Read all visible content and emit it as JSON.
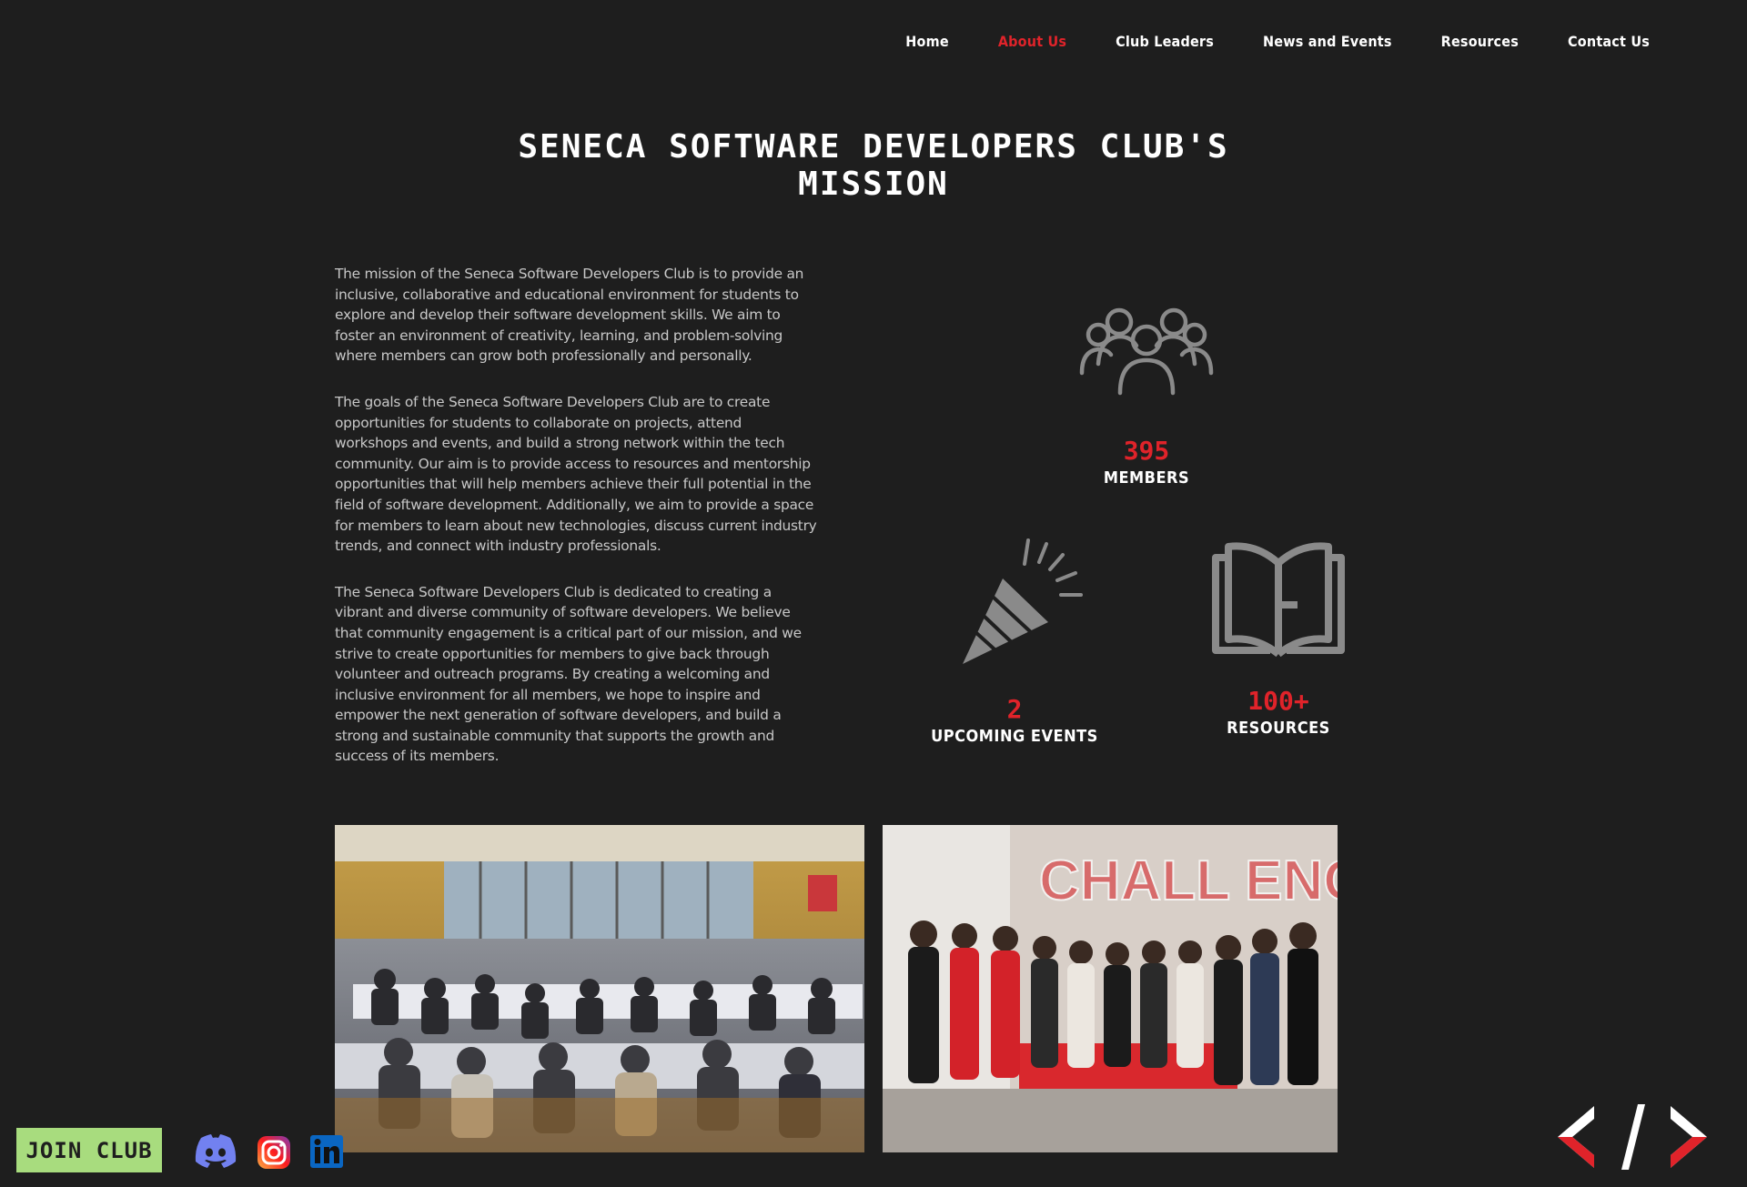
{
  "nav": {
    "items": [
      {
        "label": "Home"
      },
      {
        "label": "About Us"
      },
      {
        "label": "Club Leaders"
      },
      {
        "label": "News and Events"
      },
      {
        "label": "Resources"
      },
      {
        "label": "Contact Us"
      }
    ],
    "active": "About Us"
  },
  "mission": {
    "title_line1": "SENECA SOFTWARE DEVELOPERS CLUB'S",
    "title_line2": "MISSION",
    "paragraphs": [
      "The mission of the Seneca Software Developers Club is to provide an inclusive, collaborative and educational environment for students to explore and develop their software development skills. We aim to foster an environment of creativity, learning, and problem-solving where members can grow both professionally and personally.",
      "The goals of the Seneca Software Developers Club are to create opportunities for students to collaborate on projects, attend workshops and events, and build a strong network within the tech community. Our aim is to provide access to resources and mentorship opportunities that will help members achieve their full potential in the field of software development. Additionally, we aim to provide a space for members to learn about new technologies, discuss current industry trends, and connect with industry professionals.",
      "The Seneca Software Developers Club is dedicated to creating a vibrant and diverse community of software developers. We believe that community engagement is a critical part of our mission, and we strive to create opportunities for members to give back through volunteer and outreach programs. By creating a welcoming and inclusive environment for all members, we hope to inspire and empower the next generation of software developers, and build a strong and sustainable community that supports the growth and success of its members."
    ]
  },
  "stats": {
    "members": {
      "value": "395",
      "label": "MEMBERS",
      "icon": "people-group-icon"
    },
    "events": {
      "value": "2",
      "label": "UPCOMING EVENTS",
      "icon": "party-popper-icon"
    },
    "resources": {
      "value": "100+",
      "label": "RESOURCES",
      "icon": "open-book-icon"
    }
  },
  "photos": [
    {
      "subject": "club members seated at tables in a study hall"
    },
    {
      "subject": "club members posing in front of a CHALLENGE ACCEPTED sign"
    }
  ],
  "photo2_sign_text": "CHALL ENGE ACCE",
  "footer": {
    "join_label": "JOIN CLUB",
    "social": [
      "discord-icon",
      "instagram-icon",
      "linkedin-icon"
    ],
    "logo": "code-brackets-logo"
  },
  "colors": {
    "background": "#1e1e1e",
    "accent_red": "#e0232a",
    "join_green": "#a8dc7e",
    "icon_grey": "#8a8a8a"
  }
}
